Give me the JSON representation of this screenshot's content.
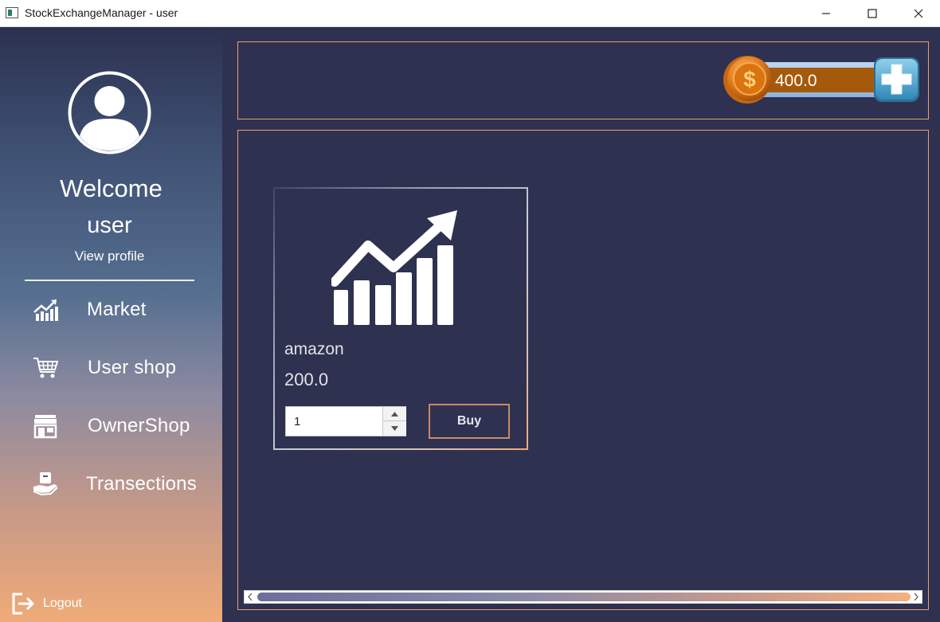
{
  "window": {
    "title": "StockExchangeManager - user"
  },
  "sidebar": {
    "welcome": "Welcome",
    "username": "user",
    "view_profile": "View profile",
    "items": [
      {
        "label": "Market",
        "icon": "chart-growth-icon"
      },
      {
        "label": "User shop",
        "icon": "cart-icon"
      },
      {
        "label": "OwnerShop",
        "icon": "store-icon"
      },
      {
        "label": "Transections",
        "icon": "hand-coin-icon"
      }
    ],
    "logout": "Logout"
  },
  "balance": {
    "value": "400.0",
    "coin_symbol": "$"
  },
  "stocks": [
    {
      "name": "amazon",
      "price": "200.0",
      "quantity": "1",
      "buy_label": "Buy"
    }
  ],
  "colors": {
    "background": "#2e3150",
    "panel_border": "#e8a070",
    "balance_fill": "#a55a0b",
    "accent_orange": "#f0ab78"
  }
}
